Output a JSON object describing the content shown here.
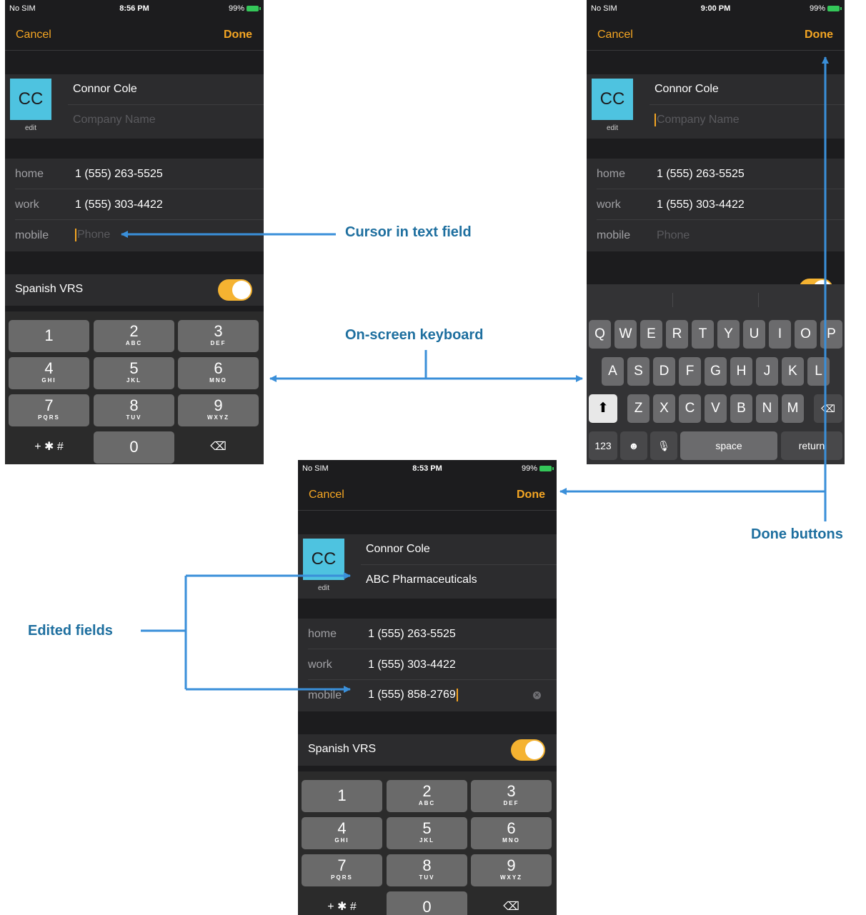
{
  "screens": [
    {
      "id": "a",
      "status": {
        "carrier": "No SIM",
        "time": "8:56 PM",
        "battery": "99%"
      },
      "nav": {
        "cancel": "Cancel",
        "done": "Done"
      },
      "avatar": {
        "initials": "CC",
        "edit": "edit"
      },
      "name": "Connor Cole",
      "company_placeholder": "Company Name",
      "phones": [
        {
          "label": "home",
          "value": "1 (555) 263-5525"
        },
        {
          "label": "work",
          "value": "1 (555) 303-4422"
        },
        {
          "label": "mobile",
          "placeholder": "Phone"
        }
      ],
      "toggle_label": "Spanish VRS"
    },
    {
      "id": "b",
      "status": {
        "carrier": "No SIM",
        "time": "9:00 PM",
        "battery": "99%"
      },
      "nav": {
        "cancel": "Cancel",
        "done": "Done"
      },
      "avatar": {
        "initials": "CC",
        "edit": "edit"
      },
      "name": "Connor Cole",
      "company_placeholder": "Company Name",
      "phones": [
        {
          "label": "home",
          "value": "1 (555) 263-5525"
        },
        {
          "label": "work",
          "value": "1 (555) 303-4422"
        },
        {
          "label": "mobile",
          "placeholder": "Phone"
        }
      ]
    },
    {
      "id": "c",
      "status": {
        "carrier": "No SIM",
        "time": "8:53 PM",
        "battery": "99%"
      },
      "nav": {
        "cancel": "Cancel",
        "done": "Done"
      },
      "avatar": {
        "initials": "CC",
        "edit": "edit"
      },
      "name": "Connor Cole",
      "company": "ABC Pharmaceuticals",
      "phones": [
        {
          "label": "home",
          "value": "1 (555) 263-5525"
        },
        {
          "label": "work",
          "value": "1 (555) 303-4422"
        },
        {
          "label": "mobile",
          "value": "1 (555) 858-2769"
        }
      ],
      "toggle_label": "Spanish VRS"
    }
  ],
  "keypad": [
    {
      "d": "1",
      "l": ""
    },
    {
      "d": "2",
      "l": "ABC"
    },
    {
      "d": "3",
      "l": "DEF"
    },
    {
      "d": "4",
      "l": "GHI"
    },
    {
      "d": "5",
      "l": "JKL"
    },
    {
      "d": "6",
      "l": "MNO"
    },
    {
      "d": "7",
      "l": "PQRS"
    },
    {
      "d": "8",
      "l": "TUV"
    },
    {
      "d": "9",
      "l": "WXYZ"
    },
    {
      "d": "+ ✱ #",
      "l": ""
    },
    {
      "d": "0",
      "l": ""
    },
    {
      "d": "⌫",
      "l": ""
    }
  ],
  "keyboard": {
    "row1": [
      "Q",
      "W",
      "E",
      "R",
      "T",
      "Y",
      "U",
      "I",
      "O",
      "P"
    ],
    "row2": [
      "A",
      "S",
      "D",
      "F",
      "G",
      "H",
      "J",
      "K",
      "L"
    ],
    "row3": [
      "Z",
      "X",
      "C",
      "V",
      "B",
      "N",
      "M"
    ],
    "numbers_key": "123",
    "space_key": "space",
    "return_key": "return",
    "shift_icon": "shift-icon",
    "delete_icon": "delete-icon",
    "emoji_icon": "emoji-icon",
    "mic_icon": "microphone-icon"
  },
  "callouts": {
    "cursor": "Cursor in text field",
    "keyboard": "On-screen keyboard",
    "done": "Done buttons",
    "edited": "Edited fields"
  },
  "colors": {
    "accent": "#f5a623",
    "avatar": "#4ec3e0",
    "callout": "#1e6f9f",
    "arrow": "#3a8fd9"
  }
}
